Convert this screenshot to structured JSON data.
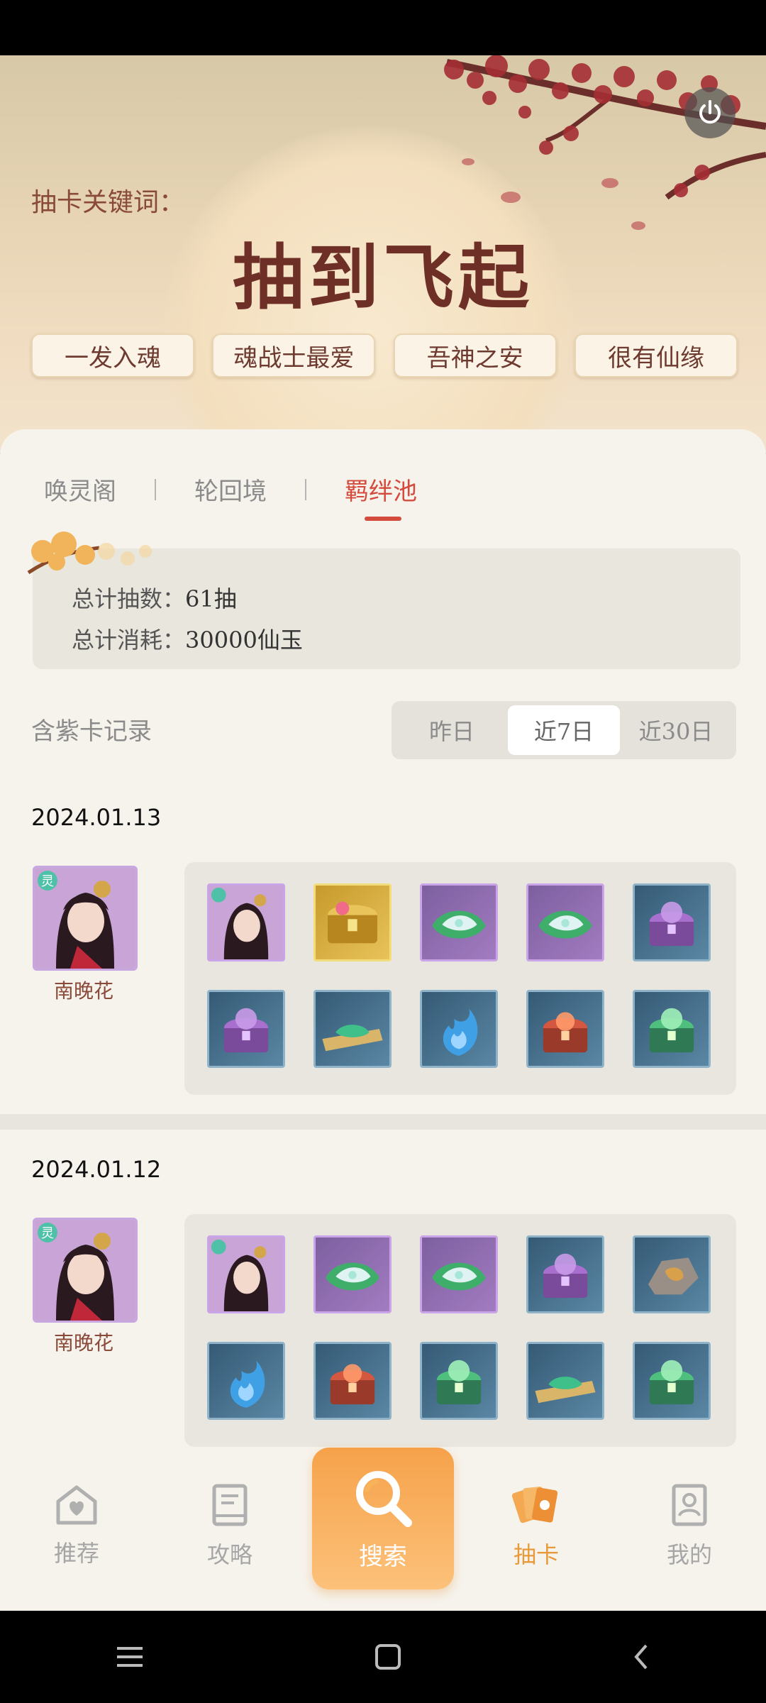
{
  "hero": {
    "keyword_label": "抽卡关键词：",
    "keyword_title": "抽到飞起",
    "tags": [
      "一发入魂",
      "魂战士最爱",
      "吾神之安",
      "很有仙缘"
    ]
  },
  "tabs": [
    {
      "label": "唤灵阁",
      "active": false
    },
    {
      "label": "轮回境",
      "active": false
    },
    {
      "label": "羁绊池",
      "active": true
    }
  ],
  "summary": {
    "total_draws_label": "总计抽数：",
    "total_draws_value": "61抽",
    "total_cost_label": "总计消耗：",
    "total_cost_value": "30000仙玉"
  },
  "records": {
    "label": "含紫卡记录",
    "periods": [
      {
        "label": "昨日",
        "selected": false
      },
      {
        "label": "近7日",
        "selected": true
      },
      {
        "label": "近30日",
        "selected": false
      }
    ]
  },
  "groups": [
    {
      "date": "2024.01.13",
      "hero_name": "南晚花",
      "hero_badge": "灵",
      "items": [
        "hero-portrait",
        "gold-chest",
        "green-jade",
        "green-jade",
        "purple-chest",
        "purple-chest",
        "jade-scroll",
        "blue-flame",
        "red-chest",
        "green-chest"
      ],
      "item_frames": [
        "purple",
        "gold",
        "purple",
        "purple",
        "blue",
        "blue",
        "blue",
        "blue",
        "blue",
        "blue"
      ]
    },
    {
      "date": "2024.01.12",
      "hero_name": "南晚花",
      "hero_badge": "灵",
      "items": [
        "hero-portrait",
        "green-jade",
        "green-jade",
        "purple-chest",
        "stone-ore",
        "blue-flame",
        "red-chest",
        "green-chest",
        "jade-scroll",
        "green-chest"
      ],
      "item_frames": [
        "purple",
        "purple",
        "purple",
        "blue",
        "blue",
        "blue",
        "blue",
        "blue",
        "blue",
        "blue"
      ]
    }
  ],
  "nav": {
    "items": [
      {
        "label": "推荐",
        "icon": "heart-home-icon"
      },
      {
        "label": "攻略",
        "icon": "book-icon"
      },
      {
        "label": "搜索",
        "icon": "search-icon"
      },
      {
        "label": "抽卡",
        "icon": "cards-icon"
      },
      {
        "label": "我的",
        "icon": "profile-icon"
      }
    ],
    "active": "抽卡"
  },
  "colors": {
    "accent": "#d44a3c",
    "nav_active": "#e89a3a",
    "search": "#f6a24a"
  }
}
